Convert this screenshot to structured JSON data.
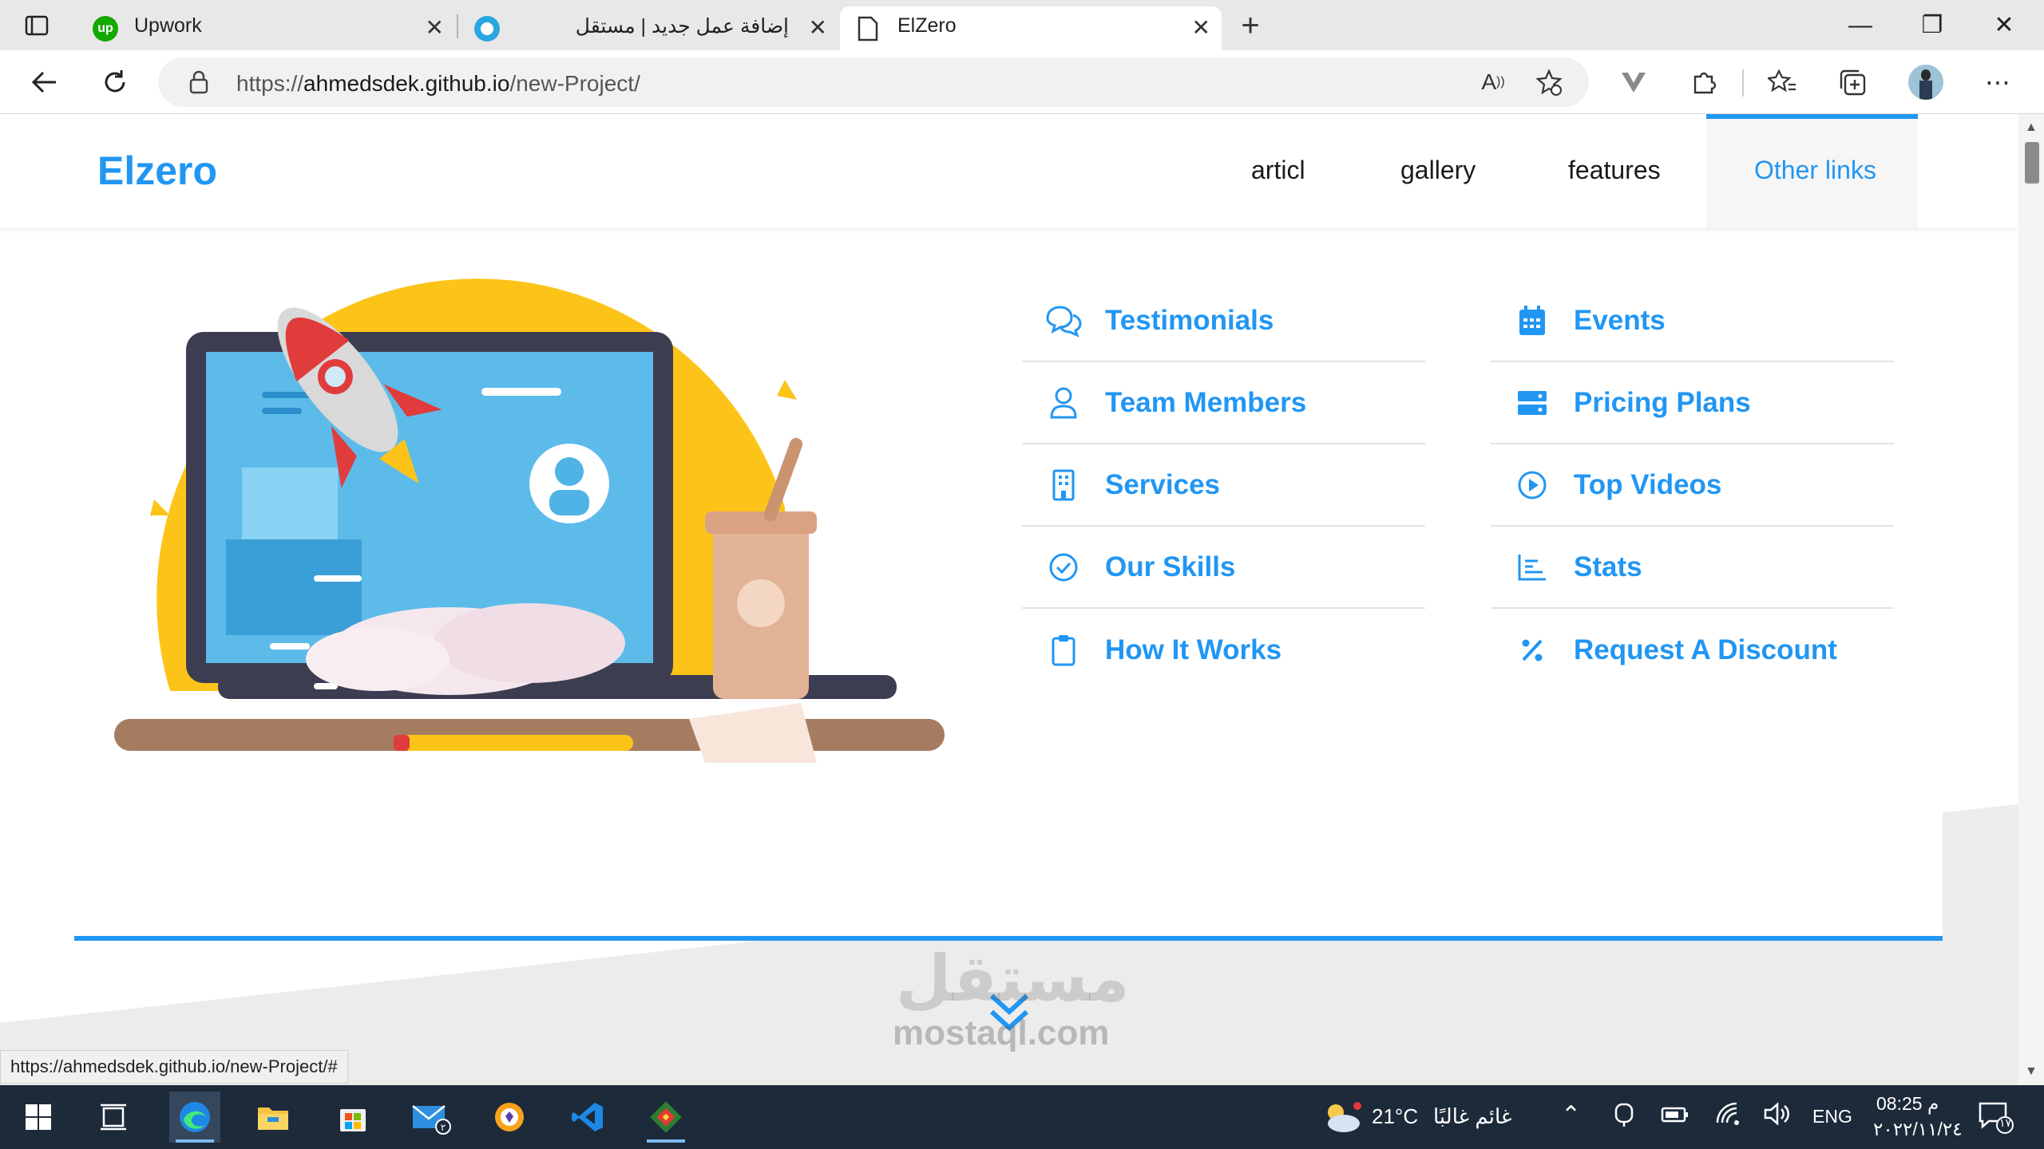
{
  "browser": {
    "tabs": [
      {
        "title": "Upwork",
        "close": "✕"
      },
      {
        "title": "إضافة عمل جديد | مستقل",
        "close": "✕"
      },
      {
        "title": "ElZero",
        "close": "✕"
      }
    ],
    "new_tab": "+",
    "address": {
      "scheme": "https://",
      "host": "ahmedsdek.github.io",
      "path": "/new-Project/"
    }
  },
  "site": {
    "logo": "Elzero",
    "nav": [
      "articl",
      "gallery",
      "features",
      "Other links"
    ]
  },
  "menu": {
    "left": [
      {
        "label": "Testimonials",
        "icon": "comments-icon"
      },
      {
        "label": "Team Members",
        "icon": "user-icon"
      },
      {
        "label": "Services",
        "icon": "building-icon"
      },
      {
        "label": "Our Skills",
        "icon": "check-circle-icon"
      },
      {
        "label": "How It Works",
        "icon": "clipboard-icon"
      }
    ],
    "right": [
      {
        "label": "Events",
        "icon": "calendar-icon"
      },
      {
        "label": "Pricing Plans",
        "icon": "server-icon"
      },
      {
        "label": "Top Videos",
        "icon": "play-circle-icon"
      },
      {
        "label": "Stats",
        "icon": "chart-icon"
      },
      {
        "label": "Request A Discount",
        "icon": "percent-icon"
      }
    ]
  },
  "status_bar_url": "https://ahmedsdek.github.io/new-Project/#",
  "watermark": {
    "arabic": "مستقل",
    "latin": "mostaql.com"
  },
  "taskbar": {
    "weather_temp": "21°C",
    "weather_text": "غائم غالبًا",
    "language": "ENG",
    "time": "08:25 م",
    "date": "٢٠٢٢/١١/٢٤",
    "notification_count": "١٧"
  },
  "colors": {
    "accent": "#2196f3",
    "taskbar": "#1c2a3a"
  }
}
